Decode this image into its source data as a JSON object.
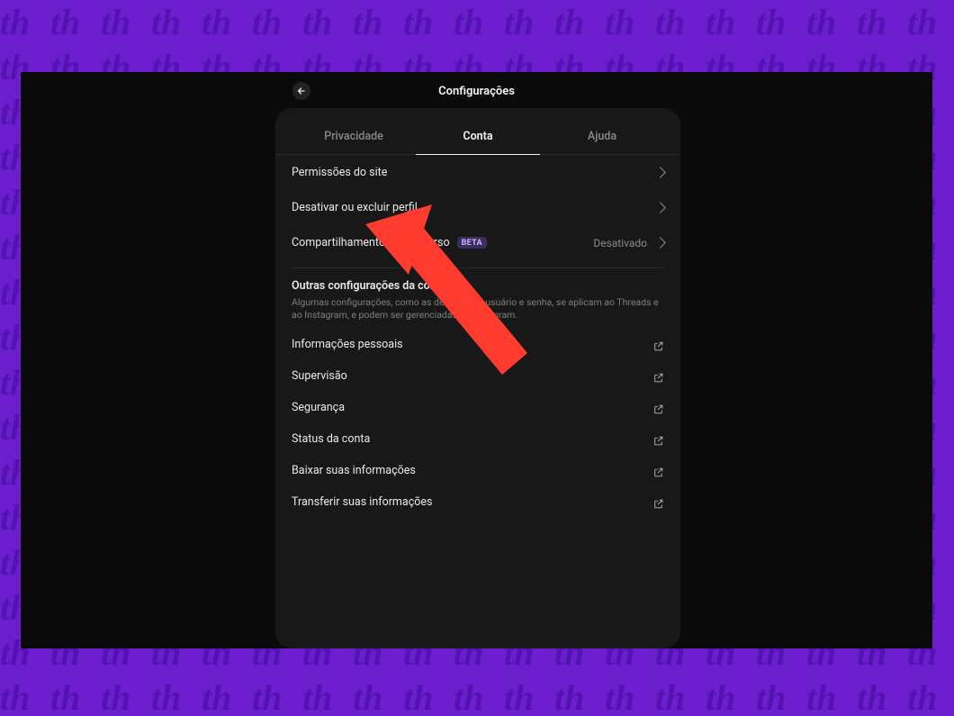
{
  "colors": {
    "bg_purple": "#6C1ECF",
    "pattern_dark": "#5313B0",
    "app_bg": "#0a0a0a",
    "panel_bg": "#181818",
    "text_primary": "#e9e9e9",
    "text_muted": "#8a8a8a",
    "arrow": "#FF3B30"
  },
  "header": {
    "title": "Configurações",
    "back_icon": "arrow-left"
  },
  "tabs": [
    {
      "id": "privacy",
      "label": "Privacidade",
      "active": false
    },
    {
      "id": "account",
      "label": "Conta",
      "active": true
    },
    {
      "id": "help",
      "label": "Ajuda",
      "active": false
    }
  ],
  "account_items": [
    {
      "id": "site_permissions",
      "label": "Permissões do site",
      "badge": null,
      "trailing_text": null,
      "action": "chevron"
    },
    {
      "id": "deactivate_delete",
      "label": "Desativar ou excluir perfil",
      "badge": null,
      "trailing_text": null,
      "action": "chevron"
    },
    {
      "id": "fediverse_sharing",
      "label": "Compartilhamento no fediverso",
      "badge": "BETA",
      "trailing_text": "Desativado",
      "action": "chevron"
    }
  ],
  "other_section": {
    "heading": "Outras configurações da conta",
    "subtext": "Algumas configurações, como as de nome de usuário e senha, se aplicam ao Threads e ao Instagram, e podem ser gerenciadas no Instagram."
  },
  "external_items": [
    {
      "id": "personal_info",
      "label": "Informações pessoais"
    },
    {
      "id": "supervision",
      "label": "Supervisão"
    },
    {
      "id": "security",
      "label": "Segurança"
    },
    {
      "id": "account_status",
      "label": "Status da conta"
    },
    {
      "id": "download_info",
      "label": "Baixar suas informações"
    },
    {
      "id": "transfer_info",
      "label": "Transferir suas informações"
    }
  ],
  "annotation": {
    "type": "arrow",
    "color": "#FF3B30",
    "points_to": "deactivate_delete"
  }
}
